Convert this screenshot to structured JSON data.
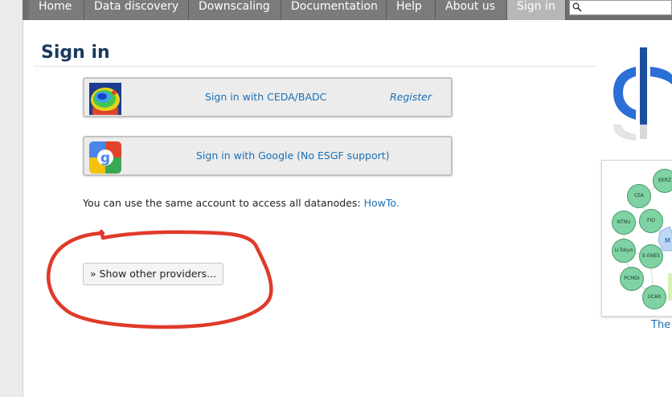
{
  "nav": {
    "items": [
      "Home",
      "Data discovery",
      "Downscaling",
      "Documentation",
      "Help",
      "About us",
      "Sign in"
    ],
    "active": "Sign in"
  },
  "page": {
    "title": "Sign in"
  },
  "signin": {
    "ceda_label": "Sign in with CEDA/BADC",
    "register_label": "Register",
    "google_label": "Sign in with Google (No ESGF support)",
    "note_text": "You can use the same account to access all datanodes: ",
    "note_link": "HowTo.",
    "other_providers": "» Show other providers..."
  },
  "sidebar": {
    "nodes": [
      "EKRZ",
      "CEA",
      "NTNU",
      "FIO",
      "U-Tokyo",
      "E-ENES",
      "PCMDI",
      "UCAR",
      "M"
    ],
    "caption": "The"
  },
  "colors": {
    "nav_bg": "#7b7b7b",
    "nav_active": "#b7b7b7",
    "link": "#1a6fb5",
    "title": "#1b3a5c",
    "annotation_red": "#e03a2a"
  }
}
